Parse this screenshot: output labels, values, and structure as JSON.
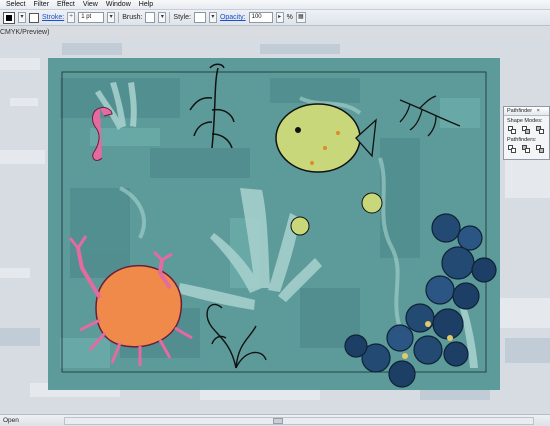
{
  "menu": [
    "Select",
    "Filter",
    "Effect",
    "View",
    "Window",
    "Help"
  ],
  "control": {
    "stroke_label": "Stroke:",
    "stroke_weight": "1 pt",
    "brush_label": "Brush:",
    "style_label": "Style:",
    "opacity_label": "Opacity:",
    "opacity_value": "100",
    "opacity_unit": "%"
  },
  "document": {
    "title": "CMYK/Preview)"
  },
  "pathfinder": {
    "tab": "Pathfinder",
    "close": "×",
    "shape_modes": "Shape Modes:",
    "pathfinders": "Pathfinders:"
  },
  "status": {
    "text": "Open"
  },
  "colors": {
    "teal": "#5d9b9a",
    "teal_dark": "#3f7c80",
    "crab_pink": "#e36ba0",
    "crab_orange": "#f08a4b",
    "fish_green": "#c7d77a",
    "navy": "#1d3f66",
    "pale_leaf": "#a9d3cf",
    "link_blue": "#1a4fd0"
  }
}
